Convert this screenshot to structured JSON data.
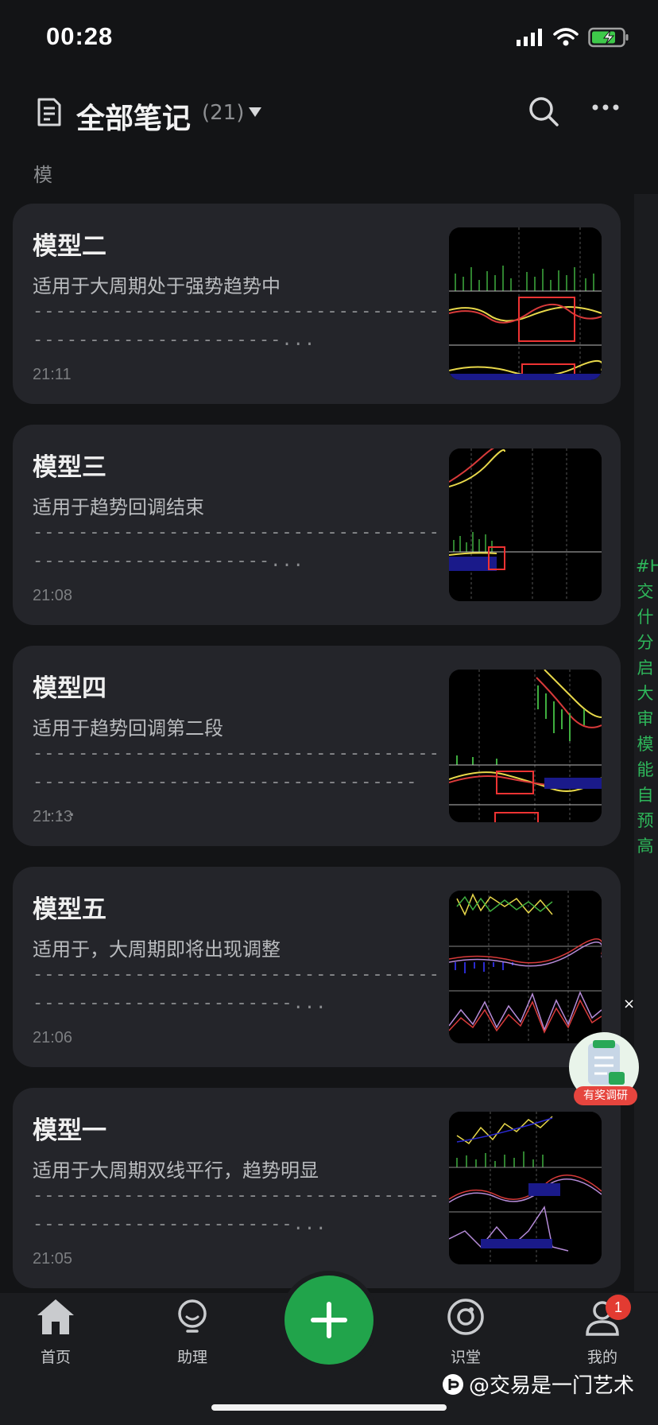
{
  "status": {
    "time": "00:28"
  },
  "header": {
    "title": "全部笔记",
    "count": "(21)"
  },
  "section": {
    "label": "模"
  },
  "notes": [
    {
      "title": "模型二",
      "desc": "适用于大周期处于强势趋势中",
      "preview": "----------------------------------------------------------...",
      "time": "21:11"
    },
    {
      "title": "模型三",
      "desc": "适用于趋势回调结束",
      "preview": "---------------------------------------------------------...",
      "time": "21:08"
    },
    {
      "title": "模型四",
      "desc": "适用于趋势回调第二段",
      "preview": "-----------------------------------------------------------------------...",
      "time": "21:13"
    },
    {
      "title": "模型五",
      "desc": "适用于，大周期即将出现调整",
      "preview": "-----------------------------------------------------------...",
      "time": "21:06"
    },
    {
      "title": "模型一",
      "desc": "适用于大周期双线平行，趋势明显",
      "preview": "-----------------------------------------------------------...",
      "time": "21:05"
    }
  ],
  "side_tag": "#H交什分启大审模能自预高",
  "float": {
    "close": "×",
    "label": "有奖调研"
  },
  "tabs": [
    {
      "label": "首页",
      "icon": "home-icon"
    },
    {
      "label": "助理",
      "icon": "lightbulb-icon"
    },
    {
      "label": "识堂",
      "icon": "discover-icon"
    },
    {
      "label": "我的",
      "icon": "person-icon"
    }
  ],
  "notification_count": "1",
  "watermark": "@交易是一门艺术",
  "colors": {
    "background": "#131416",
    "card": "#24252a",
    "accent": "#21a44b",
    "badge": "#e33b32"
  }
}
